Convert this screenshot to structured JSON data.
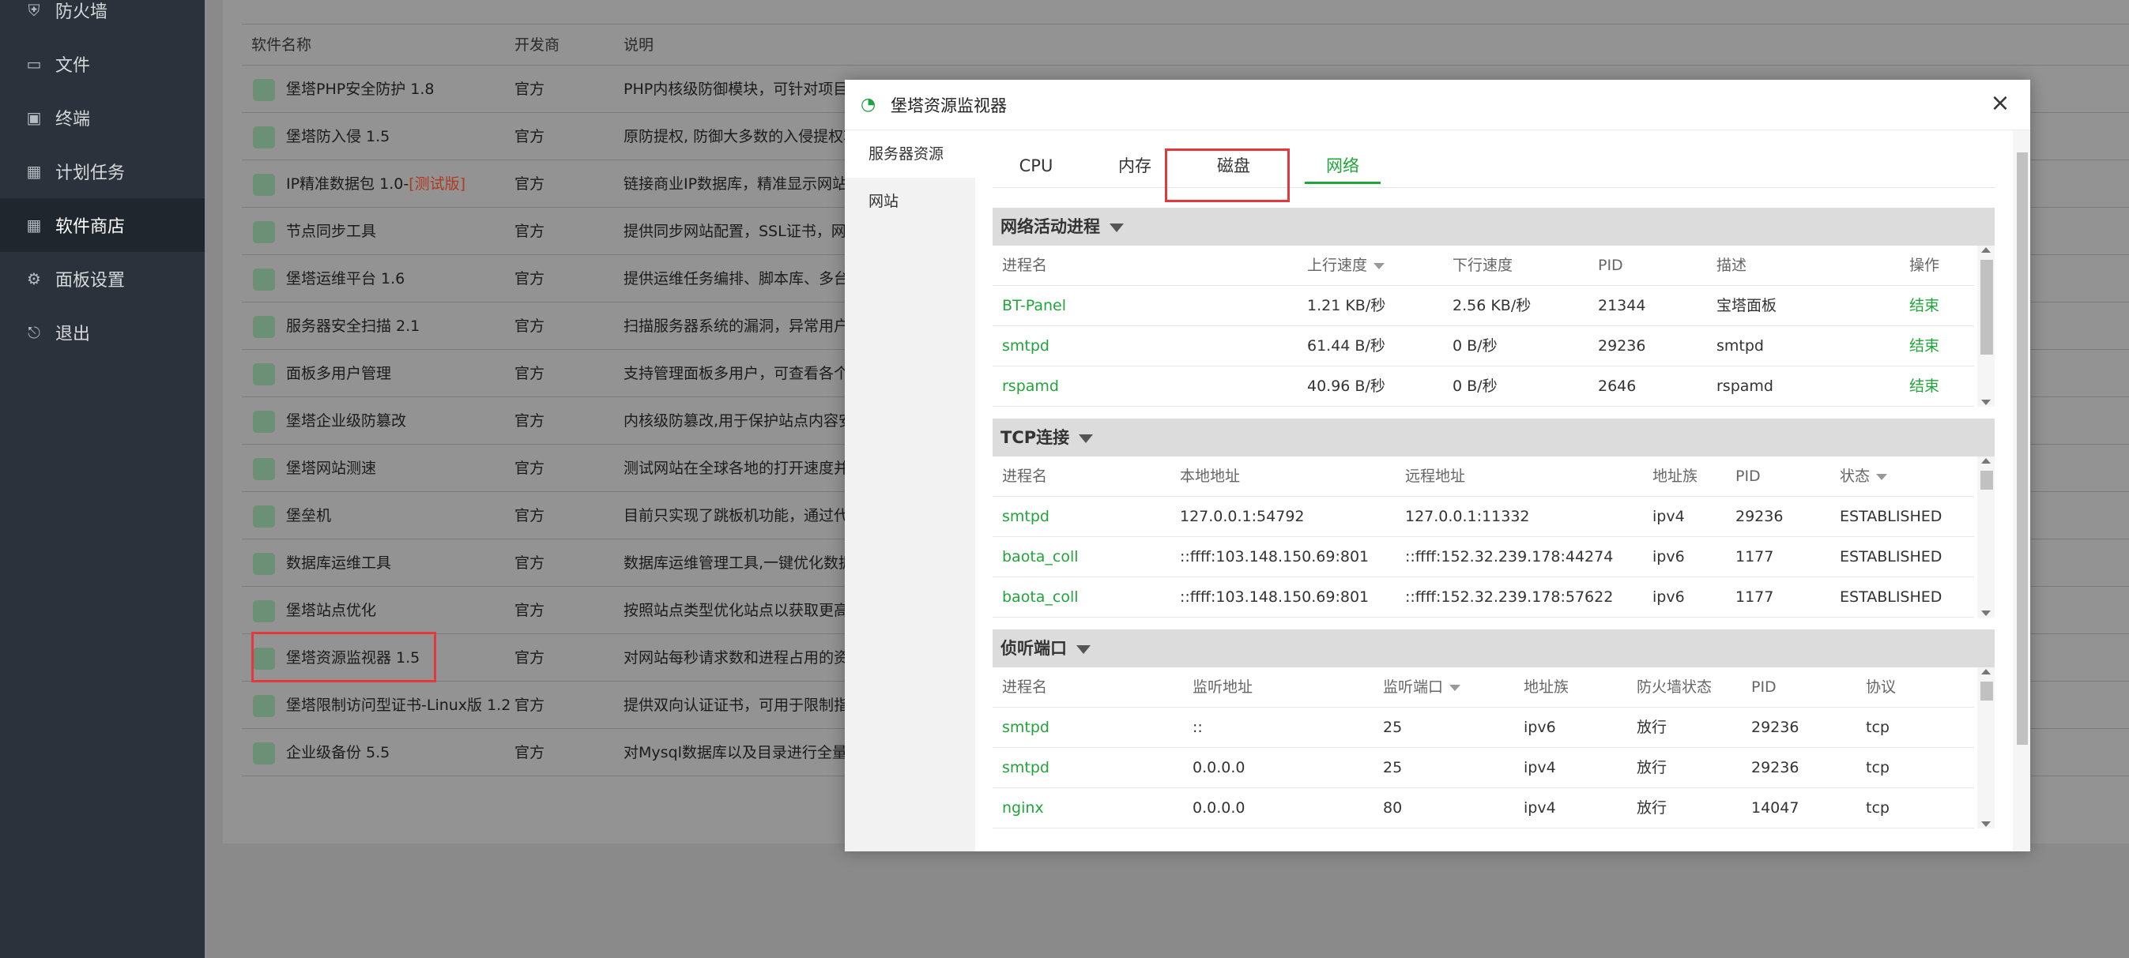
{
  "sidebar": {
    "items": [
      {
        "label": "防火墙",
        "icon": "shield-icon"
      },
      {
        "label": "文件",
        "icon": "folder-icon"
      },
      {
        "label": "终端",
        "icon": "terminal-icon"
      },
      {
        "label": "计划任务",
        "icon": "calendar-icon"
      },
      {
        "label": "软件商店",
        "icon": "grid-icon",
        "active": true
      },
      {
        "label": "面板设置",
        "icon": "gear-icon"
      },
      {
        "label": "退出",
        "icon": "logout-icon"
      }
    ]
  },
  "store": {
    "headers": [
      "软件名称",
      "开发商",
      "说明"
    ],
    "rows": [
      {
        "name": "堡塔PHP安全防护 1.8",
        "dev": "官方",
        "desc": "PHP内核级防御模块，可针对项目进"
      },
      {
        "name": "堡塔防入侵 1.5",
        "dev": "官方",
        "desc": "原防提权, 防御大多数的入侵提权攻"
      },
      {
        "name": "IP精准数据包 1.0-",
        "tag": "[测试版]",
        "dev": "官方",
        "desc": "链接商业IP数据库，精准显示网站"
      },
      {
        "name": "节点同步工具",
        "dev": "官方",
        "desc": "提供同步网站配置，SSL证书，网站"
      },
      {
        "name": "堡塔运维平台 1.6",
        "dev": "官方",
        "desc": "提供运维任务编排、脚本库、多台服"
      },
      {
        "name": "服务器安全扫描 2.1",
        "dev": "官方",
        "desc": "扫描服务器系统的漏洞，异常用户，"
      },
      {
        "name": "面板多用户管理",
        "dev": "官方",
        "desc": "支持管理面板多用户，可查看各个用"
      },
      {
        "name": "堡塔企业级防篡改",
        "dev": "官方",
        "desc": "内核级防篡改,用于保护站点内容安全"
      },
      {
        "name": "堡塔网站测速",
        "dev": "官方",
        "desc": "测试网站在全球各地的打开速度并及"
      },
      {
        "name": "堡垒机",
        "dev": "官方",
        "desc": "目前只实现了跳板机功能，通过代理"
      },
      {
        "name": "数据库运维工具",
        "dev": "官方",
        "desc": "数据库运维管理工具,一键优化数据库"
      },
      {
        "name": "堡塔站点优化",
        "dev": "官方",
        "desc": "按照站点类型优化站点以获取更高的"
      },
      {
        "name": "堡塔资源监视器 1.5",
        "dev": "官方",
        "desc": "对网站每秒请求数和进程占用的资源"
      },
      {
        "name": "堡塔限制访问型证书-Linux版 1.2",
        "dev": "官方",
        "desc": "提供双向认证证书，可用于限制指定"
      },
      {
        "name": "企业级备份 5.5",
        "dev": "官方",
        "desc": "对Mysql数据库以及目录进行全量和"
      }
    ]
  },
  "modal": {
    "title": "堡塔资源监视器",
    "close": "×",
    "side": [
      "服务器资源",
      "网站"
    ],
    "tabs": [
      "CPU",
      "内存",
      "磁盘",
      "网络"
    ],
    "net": {
      "title": "网络活动进程",
      "headers": [
        "进程名",
        "上行速度",
        "下行速度",
        "PID",
        "描述",
        "操作"
      ],
      "rows": [
        [
          "BT-Panel",
          "1.21 KB/秒",
          "2.56 KB/秒",
          "21344",
          "宝塔面板",
          "结束"
        ],
        [
          "smtpd",
          "61.44 B/秒",
          "0 B/秒",
          "29236",
          "smtpd",
          "结束"
        ],
        [
          "rspamd",
          "40.96 B/秒",
          "0 B/秒",
          "2646",
          "rspamd",
          "结束"
        ]
      ]
    },
    "tcp": {
      "title": "TCP连接",
      "headers": [
        "进程名",
        "本地地址",
        "远程地址",
        "地址族",
        "PID",
        "状态"
      ],
      "rows": [
        [
          "smtpd",
          "127.0.0.1:54792",
          "127.0.0.1:11332",
          "ipv4",
          "29236",
          "ESTABLISHED"
        ],
        [
          "baota_coll",
          "::ffff:103.148.150.69:801",
          "::ffff:152.32.239.178:44274",
          "ipv6",
          "1177",
          "ESTABLISHED"
        ],
        [
          "baota_coll",
          "::ffff:103.148.150.69:801",
          "::ffff:152.32.239.178:57622",
          "ipv6",
          "1177",
          "ESTABLISHED"
        ]
      ]
    },
    "listen": {
      "title": "侦听端口",
      "headers": [
        "进程名",
        "监听地址",
        "监听端口",
        "地址族",
        "防火墙状态",
        "PID",
        "协议"
      ],
      "rows": [
        [
          "smtpd",
          "::",
          "25",
          "ipv6",
          "放行",
          "29236",
          "tcp"
        ],
        [
          "smtpd",
          "0.0.0.0",
          "25",
          "ipv4",
          "放行",
          "29236",
          "tcp"
        ],
        [
          "nginx",
          "0.0.0.0",
          "80",
          "ipv4",
          "放行",
          "14047",
          "tcp"
        ]
      ]
    }
  }
}
